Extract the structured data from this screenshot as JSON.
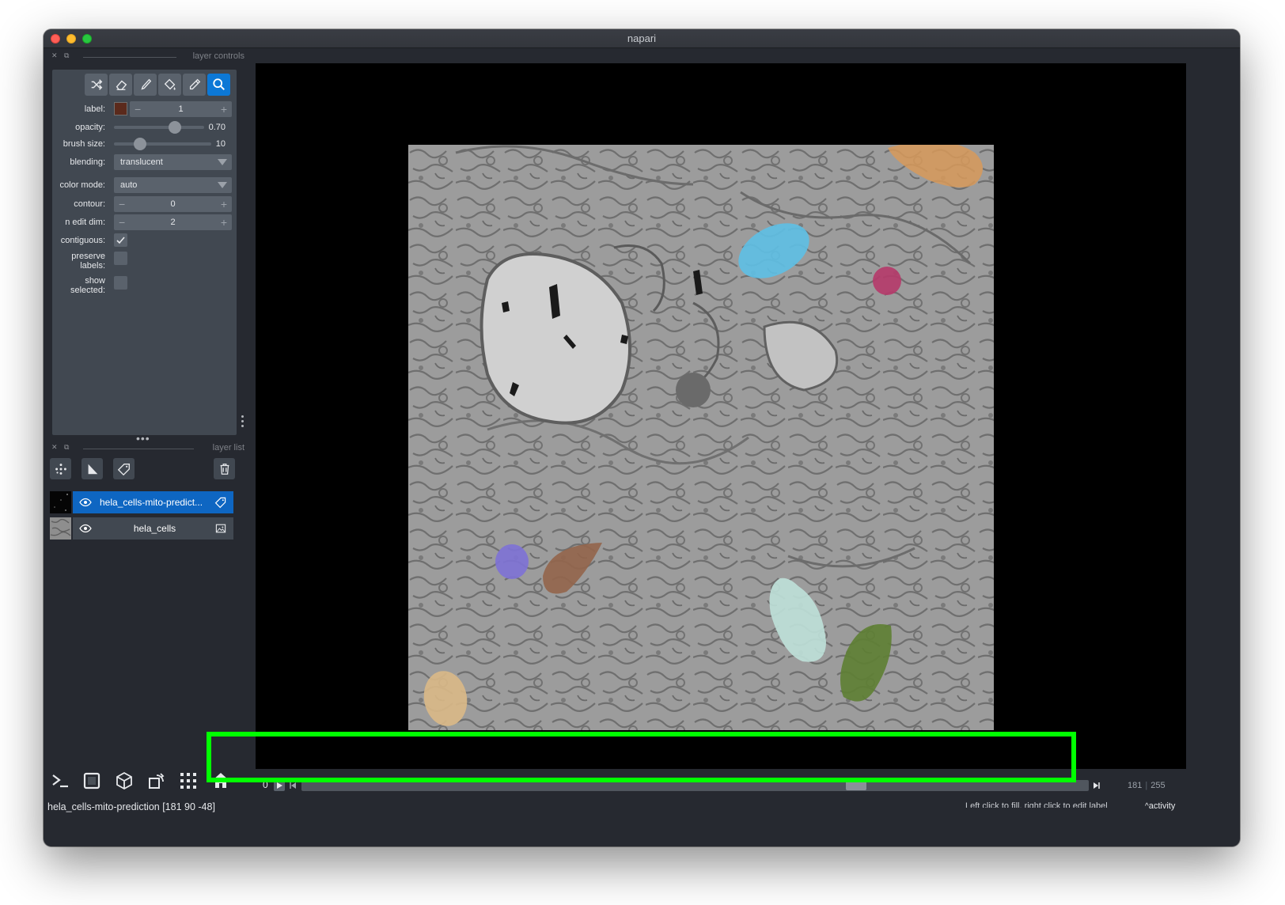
{
  "window": {
    "title": "napari"
  },
  "layer_controls": {
    "header": "layer controls",
    "tools": [
      "shuffle-icon",
      "eraser-icon",
      "paintbrush-icon",
      "fill-bucket-icon",
      "color-picker-icon",
      "zoom-icon"
    ],
    "label": {
      "label": "label:",
      "value": "1",
      "color": "#5b2a1c"
    },
    "opacity": {
      "label": "opacity:",
      "value": "0.70",
      "fraction": 0.7
    },
    "brush_size": {
      "label": "brush size:",
      "value": "10"
    },
    "blending": {
      "label": "blending:",
      "value": "translucent"
    },
    "color_mode": {
      "label": "color mode:",
      "value": "auto"
    },
    "contour": {
      "label": "contour:",
      "value": "0"
    },
    "n_edit_dim": {
      "label": "n edit dim:",
      "value": "2"
    },
    "contiguous": {
      "label": "contiguous:",
      "checked": true
    },
    "preserve_labels": {
      "label_line1": "preserve",
      "label_line2": "labels:",
      "checked": false
    },
    "show_selected": {
      "label_line1": "show",
      "label_line2": "selected:",
      "checked": false
    }
  },
  "layer_list": {
    "header": "layer list",
    "buttons": [
      "new-points-icon",
      "new-shapes-icon",
      "new-labels-icon",
      "delete-icon"
    ],
    "layers": [
      {
        "name": "hela_cells-mito-predict...",
        "type": "labels",
        "selected": true,
        "visible": true
      },
      {
        "name": "hela_cells",
        "type": "image",
        "selected": false,
        "visible": true
      }
    ]
  },
  "viewer_buttons": [
    "console-icon",
    "ndisplay-icon",
    "3d-cube-icon",
    "roll-icon",
    "grid-icon",
    "home-icon"
  ],
  "status": {
    "left": "hela_cells-mito-prediction [181  90 -48]",
    "right": "Left click to fill, right click to edit labels",
    "activity": "activity"
  },
  "dims": {
    "axis_index": "0",
    "current": "181",
    "max": "255",
    "position_fraction": 0.71
  },
  "colors": {
    "accent": "#0e66c2",
    "highlight": "#00ff00"
  }
}
